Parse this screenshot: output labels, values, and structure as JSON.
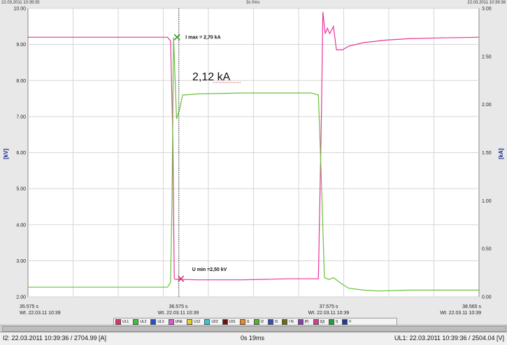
{
  "header": {
    "left_timestamp": "22.03.2011 10:39:35",
    "center_duration": "3s 0ms",
    "right_timestamp": "22.03.2011 10:39:38"
  },
  "chart_data": {
    "type": "line",
    "left_axis": {
      "label": "[kV]",
      "ylim": [
        2.0,
        10.0
      ],
      "ticks": [
        "10.00",
        "9.00",
        "8.00",
        "7.00",
        "6.00",
        "5.00",
        "4.00",
        "3.00",
        "2.00"
      ]
    },
    "right_axis": {
      "label": "[kA]",
      "ylim": [
        0.0,
        3.0
      ],
      "ticks": [
        "3.00",
        "2.50",
        "2.00",
        "1.50",
        "1.00",
        "0.50",
        "0.00"
      ]
    },
    "x_axis": {
      "xlim": [
        35.575,
        38.565
      ],
      "tick_labels": [
        {
          "time": "35.575 s",
          "date": "Wt. 22.03.11 10:39"
        },
        {
          "time": "36.575 s",
          "date": "Wt. 22.03.11 10:39"
        },
        {
          "time": "37.575 s",
          "date": "Wt. 22.03.11 10:39"
        },
        {
          "time": "38.565 s",
          "date": "Wt. 22.03.11 10:39"
        }
      ]
    },
    "grid": true,
    "cursor_x": 36.575,
    "series": [
      {
        "name": "UL1",
        "axis": "left",
        "color": "#e8339a",
        "x": [
          35.575,
          36.5,
          36.52,
          36.535,
          36.545,
          36.56,
          36.575,
          36.59,
          36.6,
          36.7,
          37.0,
          37.3,
          37.5,
          37.52,
          37.53,
          37.545,
          37.56,
          37.575,
          37.6,
          37.62,
          37.66,
          37.7,
          37.8,
          37.95,
          38.1,
          38.3,
          38.565
        ],
        "y": [
          9.2,
          9.2,
          9.1,
          6.5,
          2.5,
          2.48,
          2.5,
          2.48,
          2.48,
          2.47,
          2.47,
          2.5,
          2.5,
          7.0,
          9.9,
          9.3,
          9.45,
          9.3,
          9.5,
          8.85,
          8.85,
          8.95,
          9.05,
          9.12,
          9.16,
          9.18,
          9.2
        ]
      },
      {
        "name": "I2",
        "axis": "right",
        "color": "#66c23a",
        "x": [
          35.575,
          36.5,
          36.52,
          36.53,
          36.54,
          36.56,
          36.58,
          36.6,
          36.62,
          36.7,
          37.0,
          37.3,
          37.45,
          37.5,
          37.52,
          37.54,
          37.57,
          37.6,
          37.65,
          37.7,
          37.8,
          37.9,
          38.1,
          38.565
        ],
        "y": [
          0.1,
          0.1,
          0.15,
          1.0,
          2.7,
          1.85,
          1.95,
          2.1,
          2.1,
          2.11,
          2.12,
          2.12,
          2.12,
          2.1,
          1.2,
          0.2,
          0.18,
          0.2,
          0.14,
          0.09,
          0.07,
          0.06,
          0.07,
          0.07
        ]
      }
    ],
    "annotations": {
      "imax_text": "I max = 2,70 kA",
      "imax_point": [
        36.545,
        2.7
      ],
      "umin_text": "U min =2,50 kV",
      "umin_point": [
        36.575,
        2.5
      ],
      "big_text": "2,12 kA",
      "big_point": [
        36.66,
        2.12
      ]
    }
  },
  "legend": {
    "items": [
      {
        "name": "UL1",
        "color": "#e0306a"
      },
      {
        "name": "UL2",
        "color": "#3cc23c"
      },
      {
        "name": "UL3",
        "color": "#2850c8"
      },
      {
        "name": "UNE",
        "color": "#e055d0"
      },
      {
        "name": "U12",
        "color": "#e8d020"
      },
      {
        "name": "U23",
        "color": "#30c8d8"
      },
      {
        "name": "U31",
        "color": "#6a1010"
      },
      {
        "name": "I1",
        "color": "#e88a20"
      },
      {
        "name": "I2",
        "color": "#58b030"
      },
      {
        "name": "I3",
        "color": "#3a4ab8"
      },
      {
        "name": "I N",
        "color": "#6a6a10"
      },
      {
        "name": "|P|",
        "color": "#8a3cb0"
      },
      {
        "name": "|Q|",
        "color": "#d0408a"
      },
      {
        "name": "S",
        "color": "#20a040"
      },
      {
        "name": "F",
        "color": "#203a9a"
      }
    ]
  },
  "status_bar": {
    "left": "I2: 22.03.2011 10:39:36 / 2704.99 [A]",
    "center": "0s 19ms",
    "right": "UL1: 22.03.2011 10:39:36 / 2504.04 [V]"
  }
}
